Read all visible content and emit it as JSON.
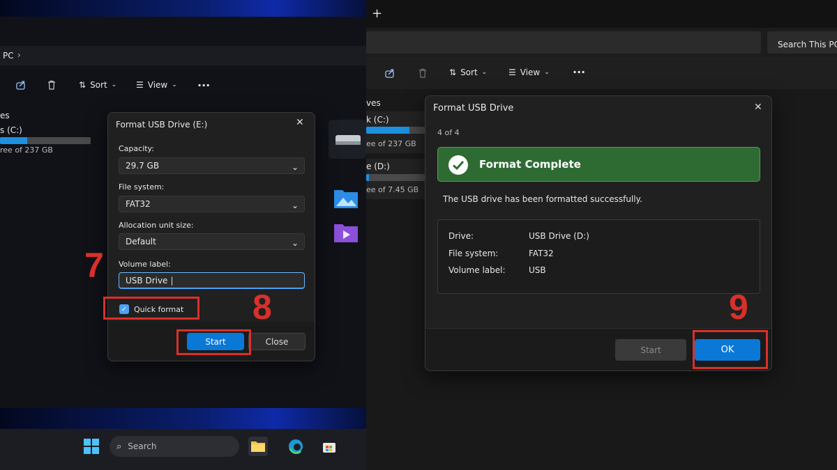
{
  "left": {
    "breadcrumb": "PC",
    "toolbar": {
      "sort": "Sort",
      "view": "View",
      "more": "···"
    },
    "sidebar": {
      "section": "es",
      "drive_c_name": "s (C:)",
      "drive_c_free": "ree of 237 GB",
      "drive_c_used_fraction": 0.3
    },
    "dialog": {
      "title": "Format USB Drive (E:)",
      "capacity_label": "Capacity:",
      "capacity_value": "29.7 GB",
      "filesystem_label": "File system:",
      "filesystem_value": "FAT32",
      "allocation_label": "Allocation unit size:",
      "allocation_value": "Default",
      "volume_label": "Volume label:",
      "volume_value": "USB Drive",
      "quick_format_label": "Quick format",
      "quick_format_checked": true,
      "start": "Start",
      "close": "Close"
    },
    "annotations": {
      "step7": "7",
      "step8": "8"
    },
    "taskbar": {
      "search_placeholder": "Search"
    }
  },
  "right": {
    "search_placeholder": "Search This PC",
    "toolbar": {
      "sort": "Sort",
      "view": "View",
      "more": "···"
    },
    "sidebar": {
      "section": "ves",
      "drive_c_name": "k (C:)",
      "drive_c_free": "ee of 237 GB",
      "drive_c_used_fraction": 0.6,
      "drive_d_name": "e (D:)",
      "drive_d_free": "ee of 7.45 GB",
      "drive_d_used_fraction": 0.05
    },
    "dialog": {
      "title": "Format USB Drive",
      "step": "4 of 4",
      "banner": "Format Complete",
      "message": "The USB drive has been formatted successfully.",
      "details": [
        {
          "label": "Drive:",
          "value": "USB Drive (D:)"
        },
        {
          "label": "File system:",
          "value": "FAT32"
        },
        {
          "label": "Volume label:",
          "value": "USB"
        }
      ],
      "start": "Start",
      "ok": "OK"
    },
    "annotations": {
      "step9": "9"
    }
  },
  "colors": {
    "accent": "#0a78d7",
    "success": "#2e6b33",
    "annotation": "#d9302b"
  }
}
